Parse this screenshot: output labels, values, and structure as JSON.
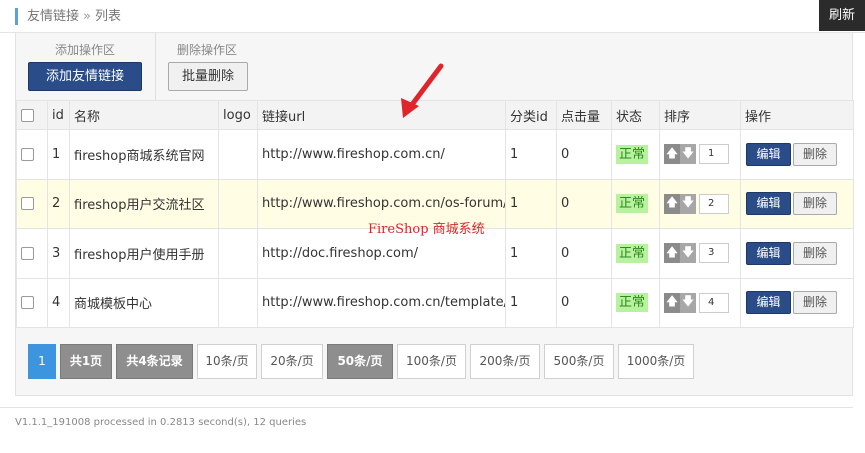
{
  "breadcrumb": {
    "parent": "友情链接",
    "separator": "»",
    "current": "列表"
  },
  "header": {
    "refresh_label": "刷新"
  },
  "toolbar": {
    "add_group_label": "添加操作区",
    "add_button": "添加友情链接",
    "delete_group_label": "删除操作区",
    "batch_delete_button": "批量删除"
  },
  "table": {
    "columns": [
      "id",
      "名称",
      "logo",
      "链接url",
      "分类id",
      "点击量",
      "状态",
      "排序",
      "操作"
    ],
    "rows": [
      {
        "id": "1",
        "name": "fireshop商城系统官网",
        "logo": "",
        "url": "http://www.fireshop.com.cn/",
        "category": "1",
        "clicks": "0",
        "status": "正常",
        "sort": "1",
        "highlight": false
      },
      {
        "id": "2",
        "name": "fireshop用户交流社区",
        "logo": "",
        "url": "http://www.fireshop.com.cn/os-forum/",
        "category": "1",
        "clicks": "0",
        "status": "正常",
        "sort": "2",
        "highlight": true
      },
      {
        "id": "3",
        "name": "fireshop用户使用手册",
        "logo": "",
        "url": "http://doc.fireshop.com/",
        "category": "1",
        "clicks": "0",
        "status": "正常",
        "sort": "3",
        "highlight": false
      },
      {
        "id": "4",
        "name": "商城模板中心",
        "logo": "",
        "url": "http://www.fireshop.com.cn/template/",
        "category": "1",
        "clicks": "0",
        "status": "正常",
        "sort": "4",
        "highlight": false
      }
    ],
    "edit_label": "编辑",
    "delete_label": "删除",
    "up_icon": "arrow-up-icon",
    "down_icon": "arrow-down-icon"
  },
  "watermark": "FireShop 商城系统",
  "pagination": {
    "current_page": "1",
    "total_pages": "共1页",
    "total_records": "共4条记录",
    "page_sizes": [
      "10条/页",
      "20条/页",
      "50条/页",
      "100条/页",
      "200条/页",
      "500条/页",
      "1000条/页"
    ],
    "selected_size": "50条/页"
  },
  "footer": {
    "text": "V1.1.1_191008 processed in 0.2813 second(s), 12 queries"
  },
  "colors": {
    "primary": "#2a4d8a",
    "pager_current": "#3d95e0",
    "status_bg": "#b8f2a0",
    "watermark": "#d8262c",
    "row_highlight": "#fffde3"
  }
}
